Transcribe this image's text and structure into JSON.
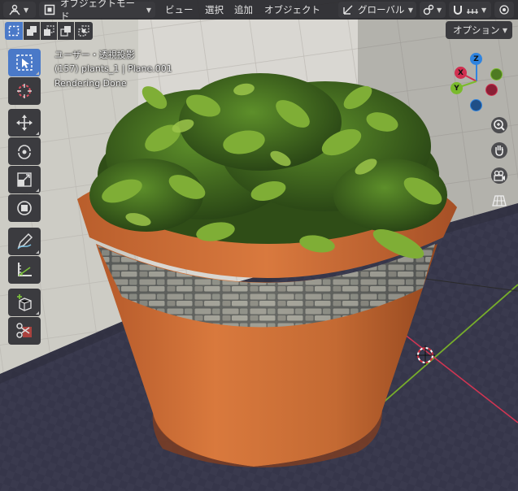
{
  "header": {
    "editor_type_icon": "editor-type-icon",
    "mode_label": "オブジェクトモード",
    "menus": [
      "ビュー",
      "選択",
      "追加",
      "オブジェクト"
    ],
    "transform_orientation": "グローバル",
    "options_label": "オプション"
  },
  "overlay": {
    "view_name": "ユーザー・透視投影",
    "object_info": "(157) plants_1 | Plane.001",
    "status": "Rendering Done"
  },
  "gizmo": {
    "x": "X",
    "y": "Y",
    "z": "Z"
  },
  "colors": {
    "accent": "#4a79c8",
    "x_axis": "#d03050",
    "y_axis": "#7aba2c",
    "z_axis": "#2f84e0"
  }
}
